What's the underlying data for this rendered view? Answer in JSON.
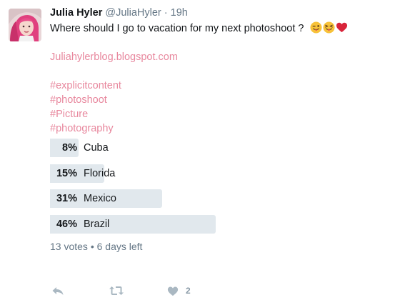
{
  "tweet": {
    "display_name": "Julia Hyler",
    "handle": "@JuliaHyler",
    "separator": "·",
    "time": "19h",
    "text": "Where should I go to vacation for my next photoshoot ?",
    "emojis": [
      "winking-tongue-face-emoji",
      "squinting-tongue-face-emoji",
      "red-heart-emoji"
    ],
    "link": "Juliahylerblog.blogspot.com",
    "hashtags": [
      "#explicitcontent",
      "#photoshoot",
      "#Picture",
      "#photography"
    ]
  },
  "poll": {
    "options": [
      {
        "label": "Cuba",
        "percent_text": "8%",
        "percent": 8
      },
      {
        "label": "Florida",
        "percent_text": "15%",
        "percent": 15
      },
      {
        "label": "Mexico",
        "percent_text": "31%",
        "percent": 31
      },
      {
        "label": "Brazil",
        "percent_text": "46%",
        "percent": 46
      }
    ],
    "meta": "13 votes • 6 days left"
  },
  "actions": {
    "like_count": "2",
    "icons": [
      "reply-icon",
      "retweet-icon",
      "heart-icon"
    ]
  },
  "colors": {
    "link": "#e8889e",
    "poll_bar": "#e1e8ed",
    "muted": "#657786"
  }
}
